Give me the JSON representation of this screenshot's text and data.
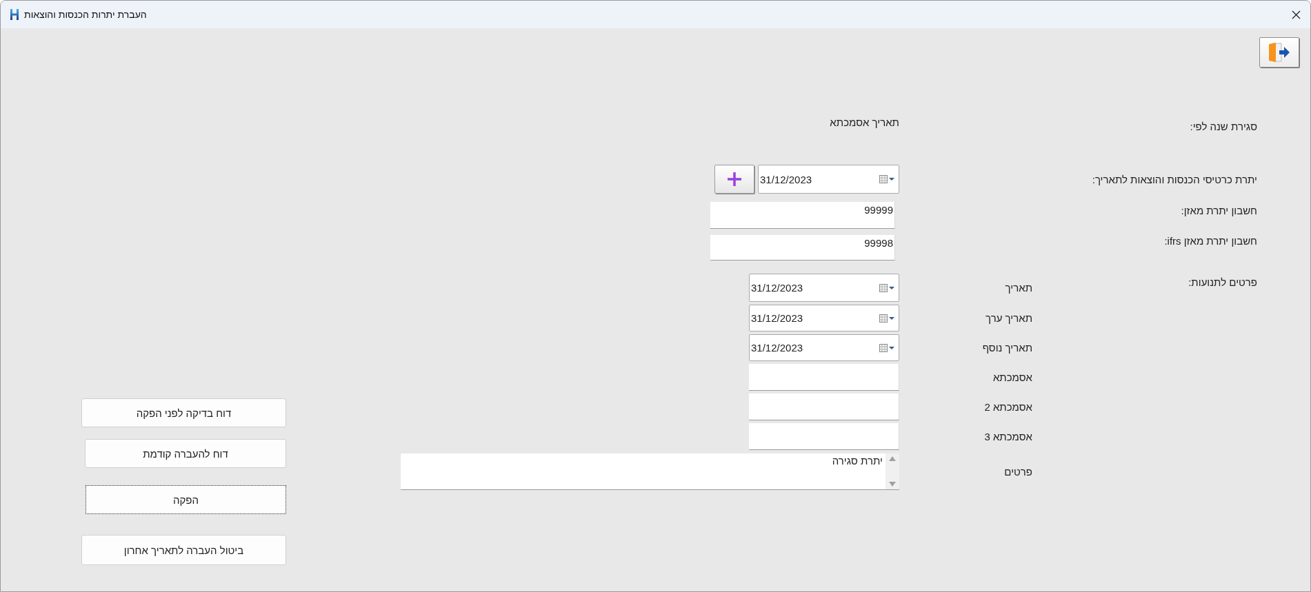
{
  "window": {
    "title": "העברת יתרות הכנסות והוצאות"
  },
  "year_close": {
    "label": "סגירת שנה לפי:",
    "option": "תאריך אסמכתא"
  },
  "balance_date": {
    "label": "יתרת כרטיסי הכנסות והוצאות לתאריך:",
    "value": "31/12/2023"
  },
  "balance_account": {
    "label": "חשבון יתרת מאזן:",
    "value": "99999"
  },
  "ifrs_account": {
    "label": "חשבון יתרת מאזן ifrs:",
    "value": "99998"
  },
  "movement_details": {
    "label": "פרטים לתנועות:",
    "fields": [
      {
        "kind": "date",
        "label": "תאריך",
        "value": "31/12/2023"
      },
      {
        "kind": "date",
        "label": "תאריך ערך",
        "value": "31/12/2023"
      },
      {
        "kind": "date",
        "label": "תאריך נוסף",
        "value": "31/12/2023"
      },
      {
        "kind": "text",
        "label": "אסמכתא"
      },
      {
        "kind": "text",
        "label": "אסמכתא 2"
      },
      {
        "kind": "text",
        "label": "אסמכתא 3"
      },
      {
        "kind": "memo",
        "label": "פרטים",
        "value": "יתרת סגירה"
      }
    ]
  },
  "buttons": [
    {
      "label": "דוח בדיקה לפני הפקה",
      "focused": false
    },
    {
      "label": "דוח להעברה קודמת",
      "focused": false
    },
    {
      "label": "הפקה",
      "focused": true
    },
    {
      "label": "ביטול העברה לתאריך אחרון",
      "focused": false
    }
  ]
}
